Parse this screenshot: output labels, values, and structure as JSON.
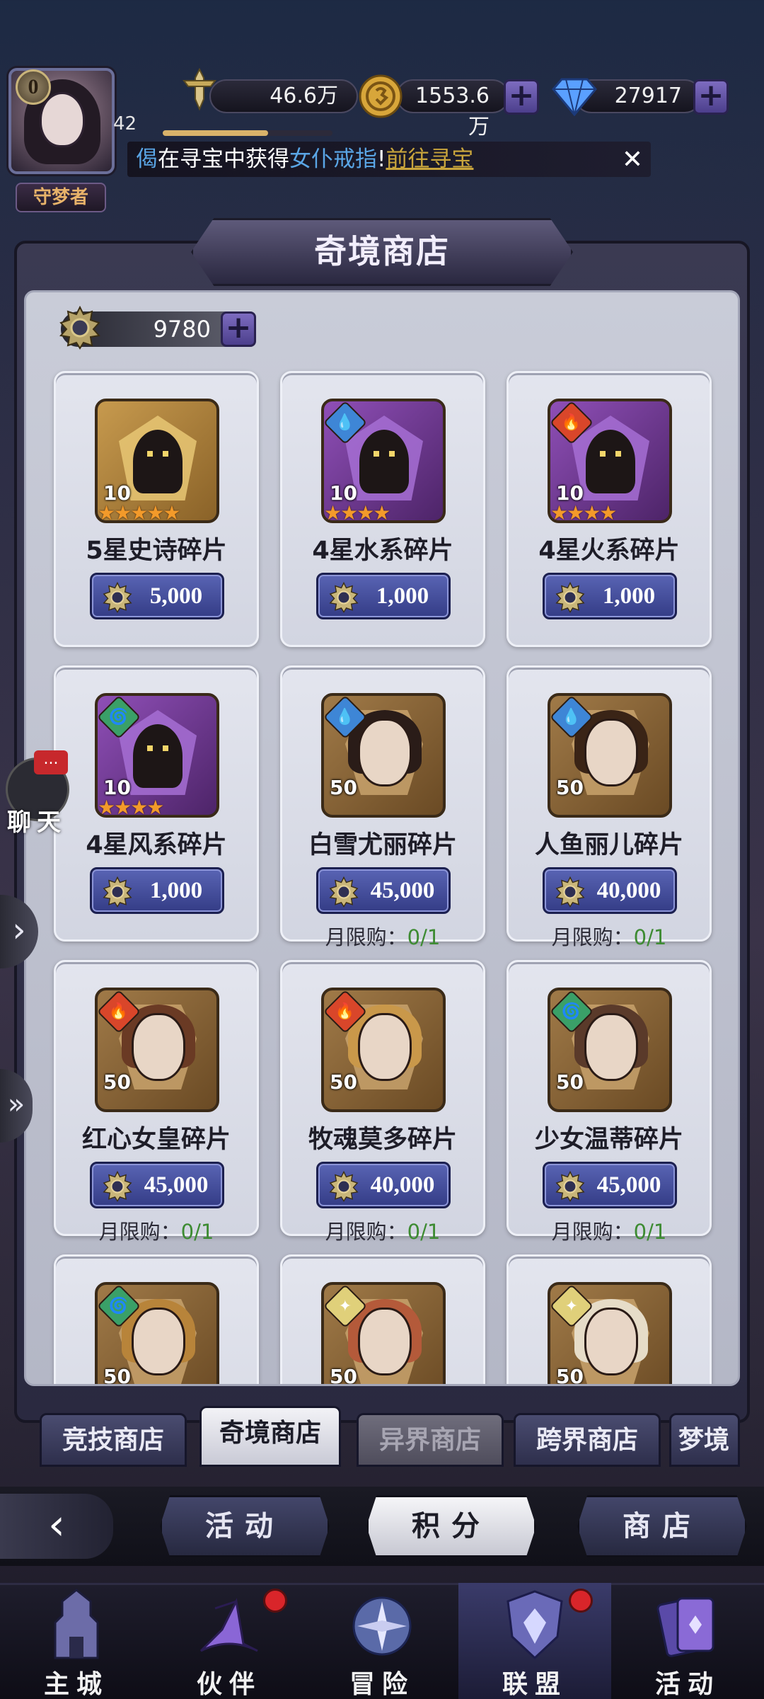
{
  "player": {
    "vip_level": "0",
    "level": "42",
    "rank_title": "守梦者",
    "xp_fraction": 0.62
  },
  "resources": {
    "power": "46.6万",
    "gold": "1553.6万",
    "diamonds": "27917"
  },
  "ticker": {
    "player": "偈",
    "text1": "在寻宝中获得",
    "item": "女仆戒指",
    "bang": "!",
    "link": "前往寻宝"
  },
  "shop": {
    "title": "奇境商店",
    "currency_balance": "9780",
    "items": [
      {
        "name": "5星史诗碎片",
        "price": "5,000",
        "qty": "10",
        "stars": "★★★★★"
      },
      {
        "name": "4星水系碎片",
        "price": "1,000",
        "qty": "10",
        "stars": "★★★★"
      },
      {
        "name": "4星火系碎片",
        "price": "1,000",
        "qty": "10",
        "stars": "★★★★"
      },
      {
        "name": "4星风系碎片",
        "price": "1,000",
        "qty": "10",
        "stars": "★★★★"
      },
      {
        "name": "白雪尤丽碎片",
        "price": "45,000",
        "qty": "50",
        "limit_label": "月限购：",
        "limit_value": "0/1"
      },
      {
        "name": "人鱼丽儿碎片",
        "price": "40,000",
        "qty": "50",
        "limit_label": "月限购：",
        "limit_value": "0/1"
      },
      {
        "name": "红心女皇碎片",
        "price": "45,000",
        "qty": "50",
        "limit_label": "月限购：",
        "limit_value": "0/1"
      },
      {
        "name": "牧魂莫多碎片",
        "price": "40,000",
        "qty": "50",
        "limit_label": "月限购：",
        "limit_value": "0/1"
      },
      {
        "name": "少女温蒂碎片",
        "price": "45,000",
        "qty": "50",
        "limit_label": "月限购：",
        "limit_value": "0/1"
      },
      {
        "qty": "50"
      },
      {
        "qty": "50"
      },
      {
        "qty": "50"
      }
    ]
  },
  "tabs": [
    "竞技商店",
    "奇境商店",
    "异界商店",
    "跨界商店",
    "梦境"
  ],
  "switch": [
    "活动",
    "积分",
    "商店"
  ],
  "nav": [
    "主城",
    "伙伴",
    "冒险",
    "联盟",
    "活动"
  ],
  "chat": {
    "label": "聊天",
    "badge": "..."
  },
  "colors": {
    "accent": "#4c3f8c",
    "price_button": "#343c86",
    "limit_ok": "#3d8b32",
    "badge_red": "#d9252a"
  }
}
